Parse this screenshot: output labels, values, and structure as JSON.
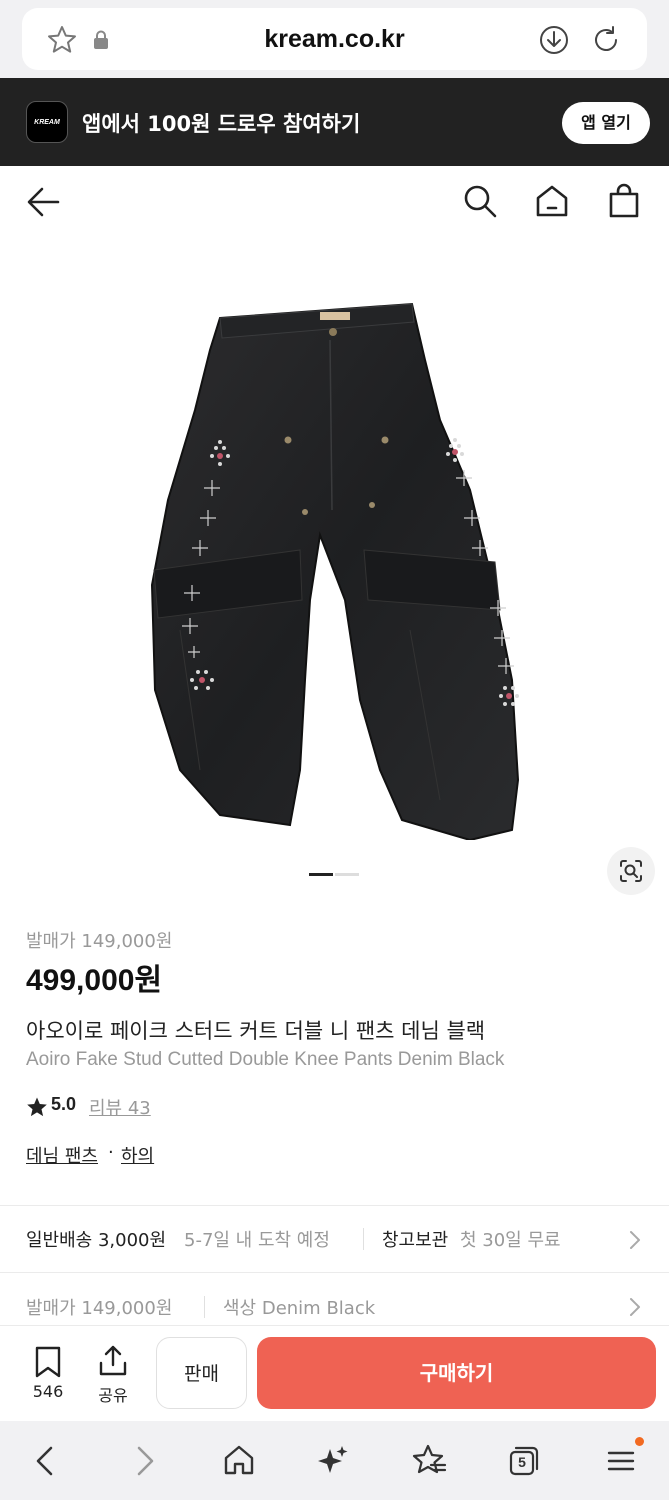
{
  "browser": {
    "url": "kream.co.kr"
  },
  "banner": {
    "logo_text": "KREAM",
    "text": "앱에서 100원 드로우 참여하기",
    "open_app": "앱 열기"
  },
  "product": {
    "image_pager": {
      "count": 2,
      "active": 1
    },
    "release_price_label": "발매가 149,000원",
    "price": "499,000원",
    "name_ko": "아오이로 페이크 스터드 커트 더블 니 팬츠 데님 블랙",
    "name_en": "Aoiro Fake Stud Cutted Double Knee Pants Denim Black",
    "rating": "5.0",
    "review_link": "리뷰 43",
    "categories": [
      "데님 팬츠",
      "하의"
    ],
    "category_separator": "·"
  },
  "info_rows": {
    "shipping": {
      "label": "일반배송 3,000원",
      "detail": "5-7일 내 도착 예정"
    },
    "storage": {
      "label": "창고보관",
      "detail": "첫 30일 무료"
    },
    "release": {
      "label": "발매가 149,000원"
    },
    "color": {
      "label": "색상 Denim Black"
    }
  },
  "action_bar": {
    "wish_count": "546",
    "share_label": "공유",
    "sell_label": "판매",
    "buy_label": "구매하기"
  },
  "browser_nav": {
    "tab_count": "5"
  },
  "colors": {
    "accent": "#ef6253",
    "banner_bg": "#222222",
    "muted_text": "#999999",
    "notification_dot": "#f26a21"
  }
}
